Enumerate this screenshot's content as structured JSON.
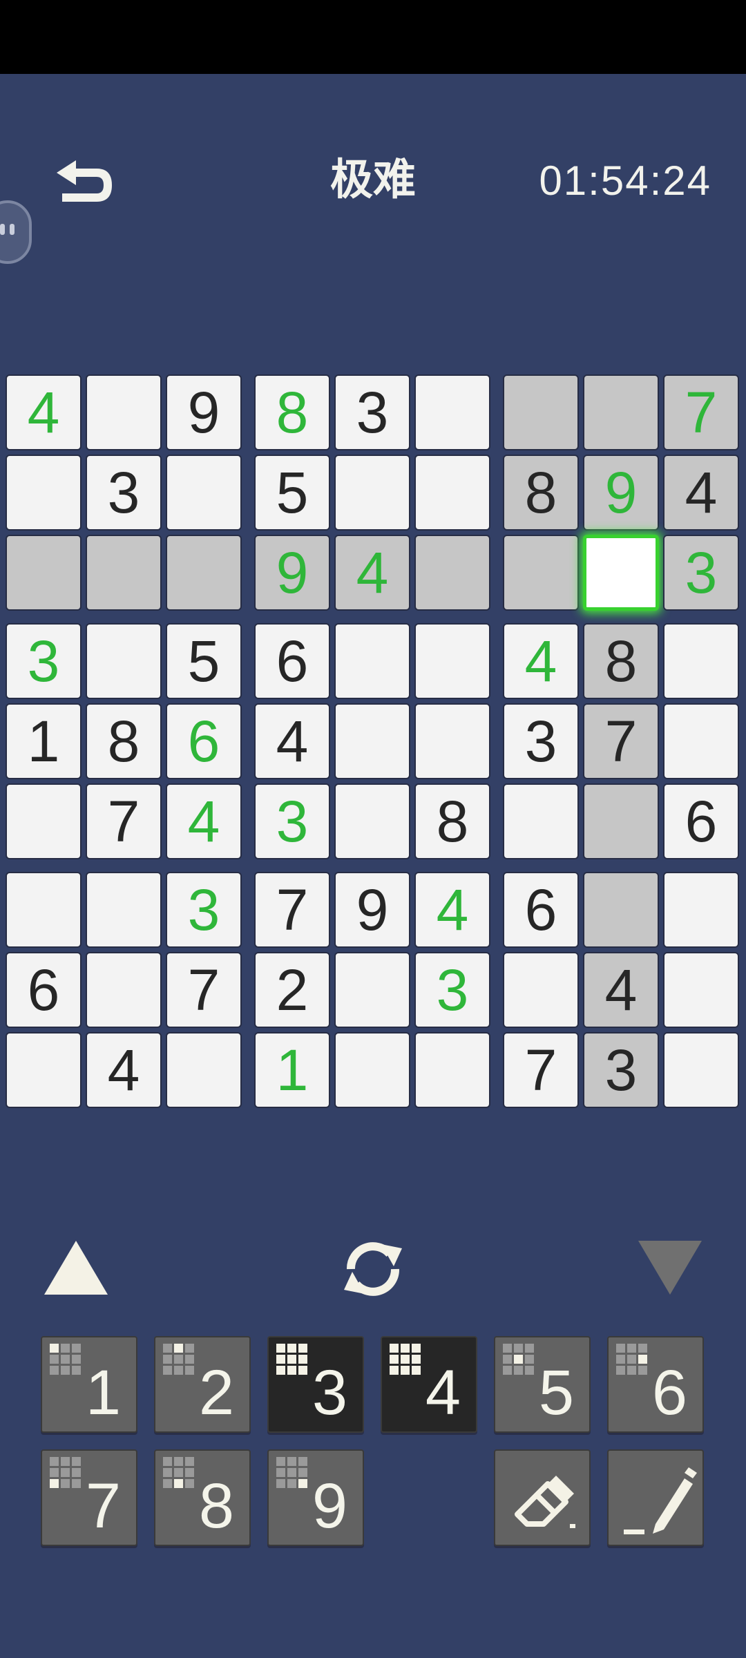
{
  "header": {
    "title": "极难",
    "timer": "01:54:24"
  },
  "board": {
    "rows": [
      [
        {
          "v": "4",
          "c": "green"
        },
        {
          "v": "",
          "c": ""
        },
        {
          "v": "9",
          "c": ""
        },
        {
          "v": "8",
          "c": "green"
        },
        {
          "v": "3",
          "c": ""
        },
        {
          "v": "",
          "c": ""
        },
        {
          "v": "",
          "c": "",
          "shade": true
        },
        {
          "v": "",
          "c": "",
          "shade": true
        },
        {
          "v": "7",
          "c": "green",
          "shade": true
        }
      ],
      [
        {
          "v": "",
          "c": ""
        },
        {
          "v": "3",
          "c": ""
        },
        {
          "v": "",
          "c": ""
        },
        {
          "v": "5",
          "c": ""
        },
        {
          "v": "",
          "c": ""
        },
        {
          "v": "",
          "c": ""
        },
        {
          "v": "8",
          "c": "",
          "shade": true
        },
        {
          "v": "9",
          "c": "green",
          "shade": true
        },
        {
          "v": "4",
          "c": "",
          "shade": true
        }
      ],
      [
        {
          "v": "",
          "c": "",
          "shade": true
        },
        {
          "v": "",
          "c": "",
          "shade": true
        },
        {
          "v": "",
          "c": "",
          "shade": true
        },
        {
          "v": "9",
          "c": "green",
          "shade": true
        },
        {
          "v": "4",
          "c": "green",
          "shade": true
        },
        {
          "v": "",
          "c": "",
          "shade": true
        },
        {
          "v": "",
          "c": "",
          "shade": true
        },
        {
          "v": "",
          "c": "",
          "selected": true
        },
        {
          "v": "3",
          "c": "green",
          "shade": true
        }
      ],
      [
        {
          "v": "3",
          "c": "green"
        },
        {
          "v": "",
          "c": ""
        },
        {
          "v": "5",
          "c": ""
        },
        {
          "v": "6",
          "c": ""
        },
        {
          "v": "",
          "c": ""
        },
        {
          "v": "",
          "c": ""
        },
        {
          "v": "4",
          "c": "green"
        },
        {
          "v": "8",
          "c": "",
          "shade": true
        },
        {
          "v": "",
          "c": ""
        }
      ],
      [
        {
          "v": "1",
          "c": ""
        },
        {
          "v": "8",
          "c": ""
        },
        {
          "v": "6",
          "c": "green"
        },
        {
          "v": "4",
          "c": ""
        },
        {
          "v": "",
          "c": ""
        },
        {
          "v": "",
          "c": ""
        },
        {
          "v": "3",
          "c": ""
        },
        {
          "v": "7",
          "c": "",
          "shade": true
        },
        {
          "v": "",
          "c": ""
        }
      ],
      [
        {
          "v": "",
          "c": ""
        },
        {
          "v": "7",
          "c": ""
        },
        {
          "v": "4",
          "c": "green"
        },
        {
          "v": "3",
          "c": "green"
        },
        {
          "v": "",
          "c": ""
        },
        {
          "v": "8",
          "c": ""
        },
        {
          "v": "",
          "c": ""
        },
        {
          "v": "",
          "c": "",
          "shade": true
        },
        {
          "v": "6",
          "c": ""
        }
      ],
      [
        {
          "v": "",
          "c": ""
        },
        {
          "v": "",
          "c": ""
        },
        {
          "v": "3",
          "c": "green"
        },
        {
          "v": "7",
          "c": ""
        },
        {
          "v": "9",
          "c": ""
        },
        {
          "v": "4",
          "c": "green"
        },
        {
          "v": "6",
          "c": ""
        },
        {
          "v": "",
          "c": "",
          "shade": true
        },
        {
          "v": "",
          "c": ""
        }
      ],
      [
        {
          "v": "6",
          "c": ""
        },
        {
          "v": "",
          "c": ""
        },
        {
          "v": "7",
          "c": ""
        },
        {
          "v": "2",
          "c": ""
        },
        {
          "v": "",
          "c": ""
        },
        {
          "v": "3",
          "c": "green"
        },
        {
          "v": "",
          "c": ""
        },
        {
          "v": "4",
          "c": "",
          "shade": true
        },
        {
          "v": "",
          "c": ""
        }
      ],
      [
        {
          "v": "",
          "c": ""
        },
        {
          "v": "4",
          "c": ""
        },
        {
          "v": "",
          "c": ""
        },
        {
          "v": "1",
          "c": "green"
        },
        {
          "v": "",
          "c": ""
        },
        {
          "v": "",
          "c": ""
        },
        {
          "v": "7",
          "c": ""
        },
        {
          "v": "3",
          "c": "",
          "shade": true
        },
        {
          "v": "",
          "c": ""
        }
      ]
    ]
  },
  "keypad": {
    "keys": [
      {
        "label": "1",
        "dark": false
      },
      {
        "label": "2",
        "dark": false
      },
      {
        "label": "3",
        "dark": true
      },
      {
        "label": "4",
        "dark": true
      },
      {
        "label": "5",
        "dark": false
      },
      {
        "label": "6",
        "dark": false
      },
      {
        "label": "7",
        "dark": false
      },
      {
        "label": "8",
        "dark": false
      },
      {
        "label": "9",
        "dark": false
      }
    ]
  },
  "icons": {
    "back": "undo-arrow-icon",
    "refresh": "refresh-icon",
    "up": "triangle-up-icon",
    "down": "triangle-down-icon",
    "eraser": "eraser-icon",
    "pencil": "pencil-icon",
    "handle": "floating-handle-icon"
  },
  "colors": {
    "background": "#334066",
    "given_green": "#2fb63a",
    "selected_glow": "#49e53f",
    "cell_blank": "#f3f3f3",
    "cell_shade": "#c6c6c6",
    "key_gray": "#626262",
    "key_dark": "#262626"
  }
}
